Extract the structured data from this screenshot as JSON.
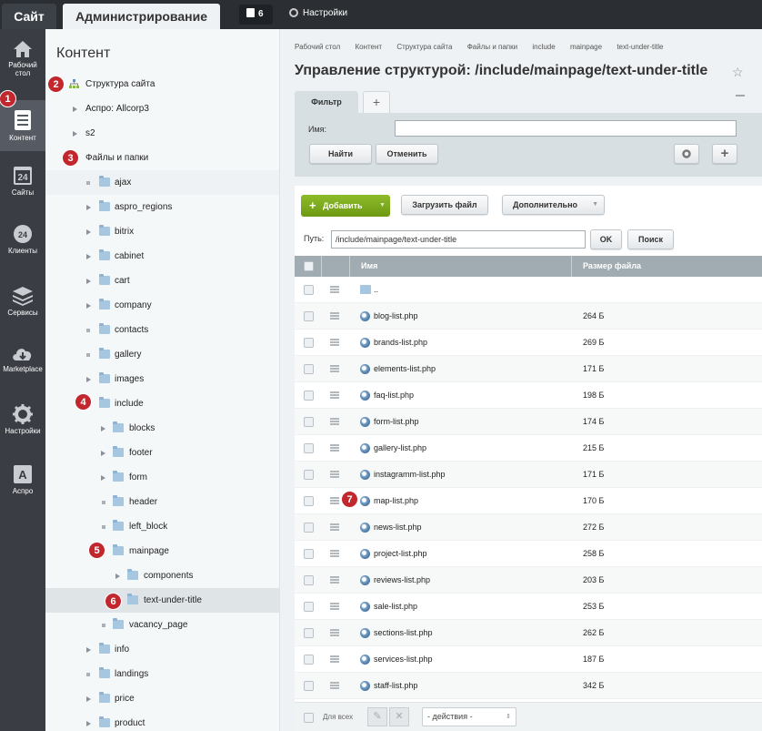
{
  "topbar": {
    "site_tab": "Сайт",
    "admin_tab": "Администрирование",
    "notifications_count": "6",
    "settings_label": "Настройки"
  },
  "leftmenu": [
    {
      "label": "Рабочий стол",
      "icon": "home-icon"
    },
    {
      "label": "Контент",
      "icon": "document-icon",
      "active": true
    },
    {
      "label": "Сайты",
      "icon": "calendar-24-icon"
    },
    {
      "label": "Клиенты",
      "icon": "clients-24-icon"
    },
    {
      "label": "Сервисы",
      "icon": "layers-icon"
    },
    {
      "label": "Marketplace",
      "icon": "cloud-download-icon"
    },
    {
      "label": "Настройки",
      "icon": "gear-icon"
    },
    {
      "label": "Аспро",
      "icon": "letter-a-icon"
    }
  ],
  "tree": {
    "title": "Контент",
    "items": [
      {
        "label": "Структура сайта"
      },
      {
        "label": "Аспро: Allcorp3"
      },
      {
        "label": "s2"
      },
      {
        "label": "Файлы и папки"
      },
      {
        "label": "ajax"
      },
      {
        "label": "aspro_regions"
      },
      {
        "label": "bitrix"
      },
      {
        "label": "cabinet"
      },
      {
        "label": "cart"
      },
      {
        "label": "company"
      },
      {
        "label": "contacts"
      },
      {
        "label": "gallery"
      },
      {
        "label": "images"
      },
      {
        "label": "include"
      },
      {
        "label": "blocks"
      },
      {
        "label": "footer"
      },
      {
        "label": "form"
      },
      {
        "label": "header"
      },
      {
        "label": "left_block"
      },
      {
        "label": "mainpage"
      },
      {
        "label": "components"
      },
      {
        "label": "text-under-title"
      },
      {
        "label": "vacancy_page"
      },
      {
        "label": "info"
      },
      {
        "label": "landings"
      },
      {
        "label": "price"
      },
      {
        "label": "product"
      }
    ]
  },
  "breadcrumbs": [
    "Рабочий стол",
    "Контент",
    "Структура сайта",
    "Файлы и папки",
    "include",
    "mainpage",
    "text-under-title"
  ],
  "page_title": "Управление структурой: /include/mainpage/text-under-title",
  "filter": {
    "tab_label": "Фильтр",
    "name_label": "Имя:",
    "name_value": "",
    "find_button": "Найти",
    "cancel_button": "Отменить"
  },
  "toolbar": {
    "add_button": "Добавить",
    "upload_button": "Загрузить файл",
    "more_button": "Дополнительно",
    "path_label": "Путь:",
    "path_value": "/include/mainpage/text-under-title",
    "ok_button": "OK",
    "search_button": "Поиск"
  },
  "grid": {
    "col_name": "Имя",
    "col_size": "Размер файла",
    "up_label": "..",
    "rows": [
      {
        "name": "blog-list.php",
        "size": "264 Б"
      },
      {
        "name": "brands-list.php",
        "size": "269 Б"
      },
      {
        "name": "elements-list.php",
        "size": "171 Б"
      },
      {
        "name": "faq-list.php",
        "size": "198 Б"
      },
      {
        "name": "form-list.php",
        "size": "174 Б"
      },
      {
        "name": "gallery-list.php",
        "size": "215 Б"
      },
      {
        "name": "instagramm-list.php",
        "size": "171 Б"
      },
      {
        "name": "map-list.php",
        "size": "170 Б"
      },
      {
        "name": "news-list.php",
        "size": "272 Б"
      },
      {
        "name": "project-list.php",
        "size": "258 Б"
      },
      {
        "name": "reviews-list.php",
        "size": "203 Б"
      },
      {
        "name": "sale-list.php",
        "size": "253 Б"
      },
      {
        "name": "sections-list.php",
        "size": "262 Б"
      },
      {
        "name": "services-list.php",
        "size": "187 Б"
      },
      {
        "name": "staff-list.php",
        "size": "342 Б"
      }
    ],
    "for_all_label": "Для всех",
    "actions_select": "- действия -"
  },
  "badges": [
    "1",
    "2",
    "3",
    "4",
    "5",
    "6",
    "7"
  ],
  "colors": {
    "topbar": "#2b2e33",
    "leftmenu": "#3a3d44",
    "accent_green": "#7aa81d",
    "badge_red": "#c1272d"
  }
}
